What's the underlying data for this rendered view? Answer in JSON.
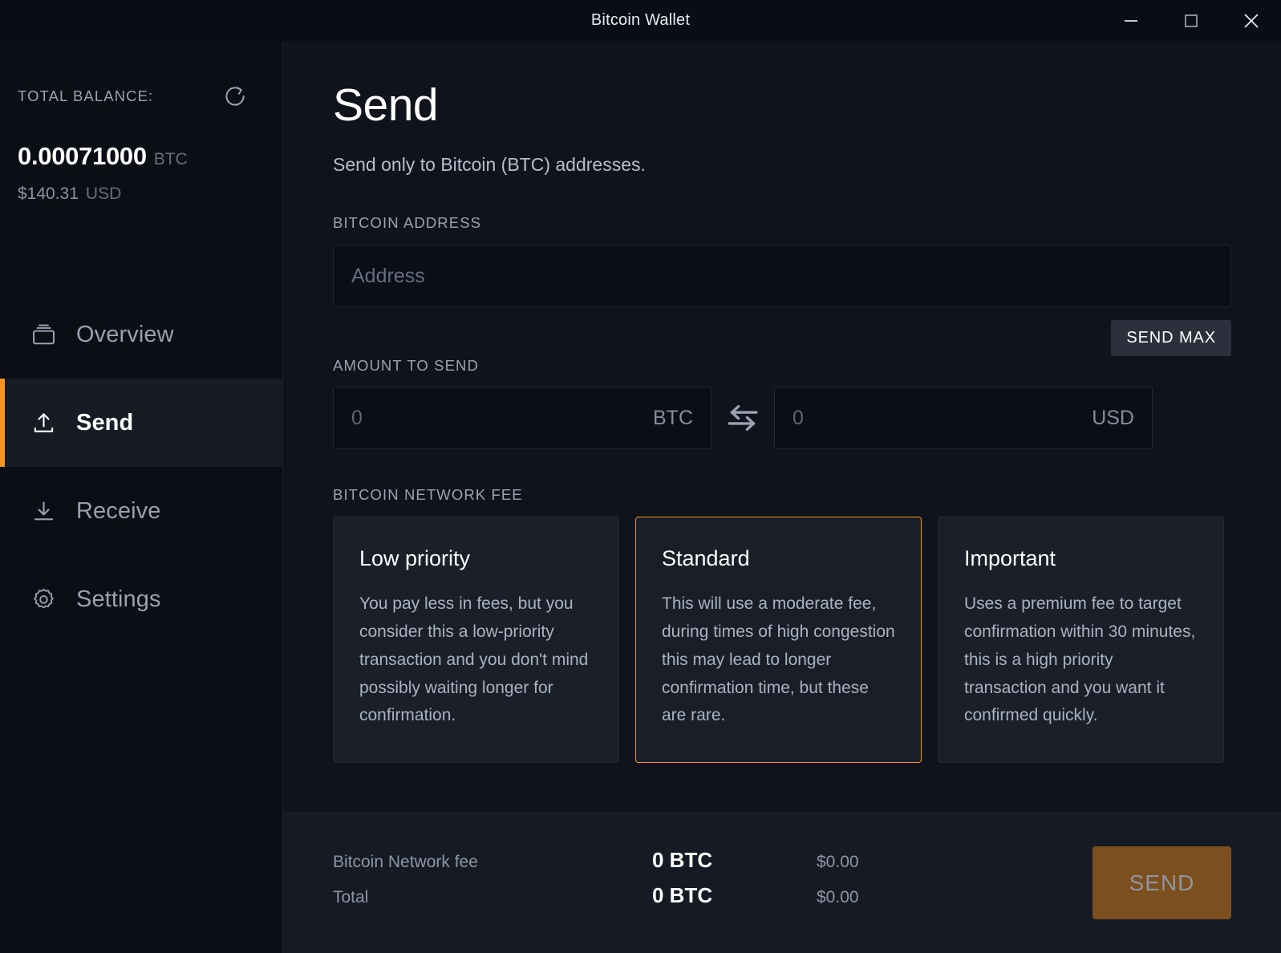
{
  "window": {
    "title": "Bitcoin Wallet",
    "controls": {
      "minimize": "minimize-icon",
      "maximize": "maximize-icon",
      "close": "close-icon"
    }
  },
  "sidebar": {
    "balance": {
      "label": "TOTAL BALANCE:",
      "btc_amount": "0.00071000",
      "btc_unit": "BTC",
      "usd_amount": "$140.31",
      "usd_unit": "USD",
      "refresh_icon": "refresh-icon"
    },
    "items": [
      {
        "label": "Overview",
        "icon": "wallet-icon",
        "active": false
      },
      {
        "label": "Send",
        "icon": "upload-arrow-icon",
        "active": true
      },
      {
        "label": "Receive",
        "icon": "download-arrow-icon",
        "active": false
      },
      {
        "label": "Settings",
        "icon": "gear-icon",
        "active": false
      }
    ]
  },
  "main": {
    "title": "Send",
    "subtitle": "Send only to Bitcoin (BTC) addresses.",
    "address": {
      "label": "BITCOIN ADDRESS",
      "placeholder": "Address",
      "value": ""
    },
    "amount": {
      "label": "AMOUNT TO SEND",
      "send_max_label": "SEND MAX",
      "btc_placeholder": "0",
      "btc_unit": "BTC",
      "usd_placeholder": "0",
      "usd_unit": "USD",
      "swap_icon": "swap-arrows-icon"
    },
    "fee": {
      "label": "BITCOIN NETWORK FEE",
      "options": [
        {
          "title": "Low priority",
          "description": "You pay less in fees, but you consider this a low-priority transaction and you don't mind possibly waiting longer for confirmation.",
          "selected": false
        },
        {
          "title": "Standard",
          "description": "This will use a moderate fee, during times of high congestion this may lead to longer confirmation time, but these are rare.",
          "selected": true
        },
        {
          "title": "Important",
          "description": "Uses a premium fee to target confirmation within 30 minutes, this is a high priority transaction and you want it confirmed quickly.",
          "selected": false
        }
      ]
    }
  },
  "footer": {
    "rows": [
      {
        "label": "Bitcoin Network fee",
        "btc": "0 BTC",
        "usd": "$0.00"
      },
      {
        "label": "Total",
        "btc": "0 BTC",
        "usd": "$0.00"
      }
    ],
    "send_button": "SEND"
  },
  "colors": {
    "accent": "#f7941e",
    "send_button_disabled": "#7c4f1e",
    "sidebar_bg": "#0b0e15",
    "main_bg": "#10131c",
    "footer_bg": "#161a24"
  }
}
